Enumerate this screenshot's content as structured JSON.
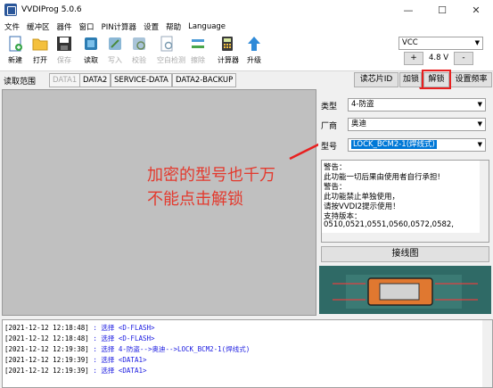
{
  "window": {
    "title": "VVDIProg 5.0.6",
    "minimize": "—",
    "maximize": "☐",
    "close": "✕"
  },
  "menu": [
    "文件",
    "缓冲区",
    "器件",
    "窗口",
    "PIN计算器",
    "设置",
    "帮助",
    "Language"
  ],
  "toolbar": [
    {
      "label": "新建",
      "icon": "new-file-icon",
      "enabled": true
    },
    {
      "label": "打开",
      "icon": "open-folder-icon",
      "enabled": true
    },
    {
      "label": "保存",
      "icon": "save-disk-icon",
      "enabled": false
    },
    {
      "label": "读取",
      "icon": "read-chip-icon",
      "enabled": true
    },
    {
      "label": "写入",
      "icon": "write-chip-icon",
      "enabled": false
    },
    {
      "label": "校验",
      "icon": "verify-chip-icon",
      "enabled": false
    },
    {
      "label": "空白检测",
      "icon": "blank-check-icon",
      "enabled": false
    },
    {
      "label": "擦除",
      "icon": "erase-icon",
      "enabled": false
    },
    {
      "label": "计算器",
      "icon": "calculator-icon",
      "enabled": true
    },
    {
      "label": "升级",
      "icon": "upgrade-arrow-icon",
      "enabled": true
    }
  ],
  "voltage": {
    "select": "VCC",
    "plus": "+",
    "value": "4.8 V",
    "minus": "-"
  },
  "readbar": {
    "label": "读取范围",
    "tabs": [
      "DATA1",
      "DATA2",
      "SERVICE-DATA",
      "DATA2-BACKUP"
    ],
    "read_id": "读芯片ID",
    "encrypt": "加锁",
    "unlock": "解锁",
    "set_freq": "设置频率"
  },
  "annotation": "加密的型号也千万\n不能点击解锁",
  "device": {
    "type_label": "类型",
    "type_value": "4-防盗",
    "maker_label": "厂商",
    "maker_value": "奥迪",
    "model_label": "型号",
    "model_value": "LOCK_BCM2-1(焊线式)"
  },
  "warning": [
    "警告：",
    "  此功能一切后果由使用者自行承担!",
    "警告：",
    "  此功能禁止单独使用，",
    "  请按VVDI2提示使用！",
    "支持版本：",
    "         0510,0521,0551,0560,0572,0582,"
  ],
  "wiring_button": "接线图",
  "log": [
    {
      "ts": "[2021-12-12 12:18:48]",
      "msg": " : 选择 <D-FLASH>"
    },
    {
      "ts": "[2021-12-12 12:18:48]",
      "msg": " : 选择 <D-FLASH>"
    },
    {
      "ts": "[2021-12-12 12:19:38]",
      "msg": " : 选择 4-防盗-->奥迪-->LOCK_BCM2-1(焊线式)"
    },
    {
      "ts": "[2021-12-12 12:19:39]",
      "msg": " : 选择 <DATA1>"
    },
    {
      "ts": "[2021-12-12 12:19:39]",
      "msg": " : 选择 <DATA1>"
    }
  ],
  "colors": {
    "annotation": "#e33a2e",
    "highlight_box": "#e82020",
    "selection": "#0078d7",
    "log_message": "#1a1ae0"
  }
}
